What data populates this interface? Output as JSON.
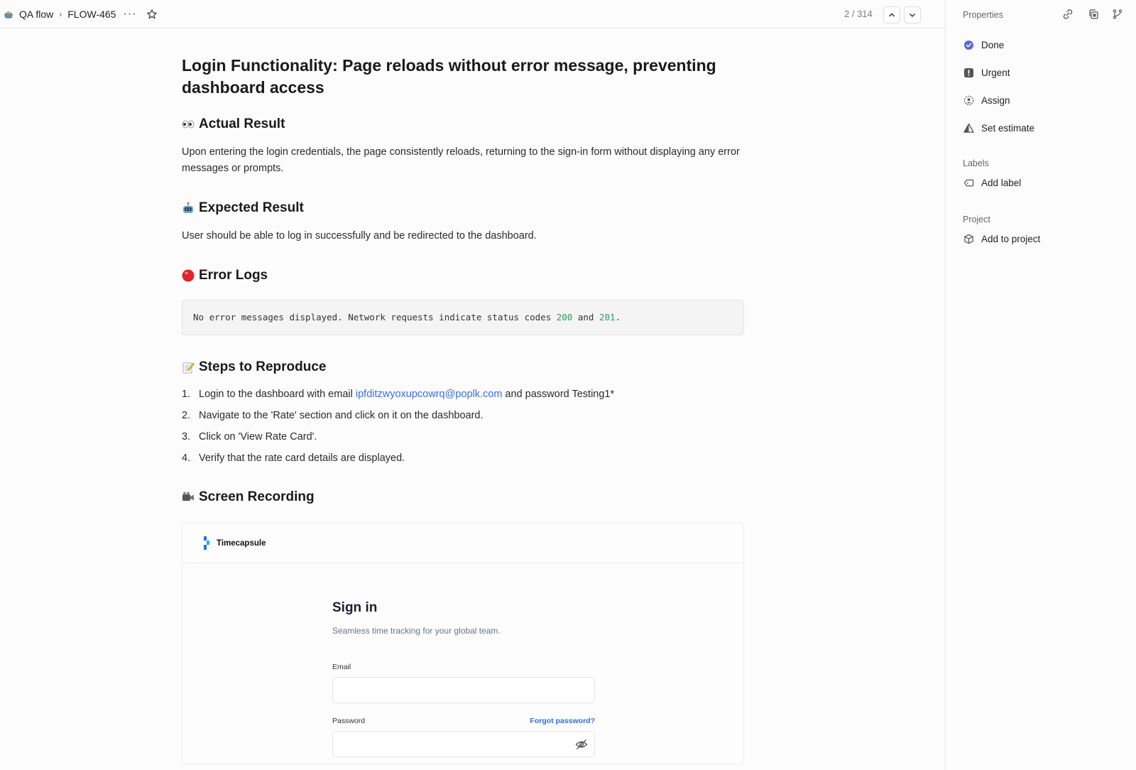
{
  "topbar": {
    "team": "QA flow",
    "issue_id": "FLOW-465",
    "more_label": "···",
    "count": "2 / 314"
  },
  "sidebar": {
    "title": "Properties",
    "status": "Done",
    "priority": "Urgent",
    "assign": "Assign",
    "estimate": "Set estimate",
    "labels_heading": "Labels",
    "add_label": "Add label",
    "project_heading": "Project",
    "add_project": "Add to project",
    "colors": {
      "done": "#5e6ad2"
    }
  },
  "issue": {
    "title": "Login Functionality: Page reloads without error message, preventing dashboard access",
    "actual": {
      "heading": "Actual Result",
      "body": "Upon entering the login credentials, the page consistently reloads, returning to the sign-in form without displaying any error messages or prompts."
    },
    "expected": {
      "heading": "Expected Result",
      "body": "User should be able to log in successfully and be redirected to the dashboard."
    },
    "errors": {
      "heading": "Error Logs",
      "code_pre": "No error messages displayed. Network requests indicate status codes ",
      "code_200": "200",
      "code_and": " and ",
      "code_201": "201",
      "code_end": "."
    },
    "steps": {
      "heading": "Steps to Reproduce",
      "items": [
        {
          "n": "1.",
          "pre": "Login to the dashboard with email ",
          "link": "ipfditzwyoxupcowrq@poplk.com",
          "post": " and password Testing1*"
        },
        {
          "n": "2.",
          "text": "Navigate to the 'Rate' section and click on it on the dashboard."
        },
        {
          "n": "3.",
          "text": "Click on 'View Rate Card'."
        },
        {
          "n": "4.",
          "text": "Verify that the rate card details are displayed."
        }
      ]
    },
    "recording": {
      "heading": "Screen Recording",
      "app_name": "Timecapsule",
      "signin_title": "Sign in",
      "signin_sub": "Seamless time tracking for your global team.",
      "email_label": "Email",
      "password_label": "Password",
      "forgot": "Forgot password?"
    }
  }
}
